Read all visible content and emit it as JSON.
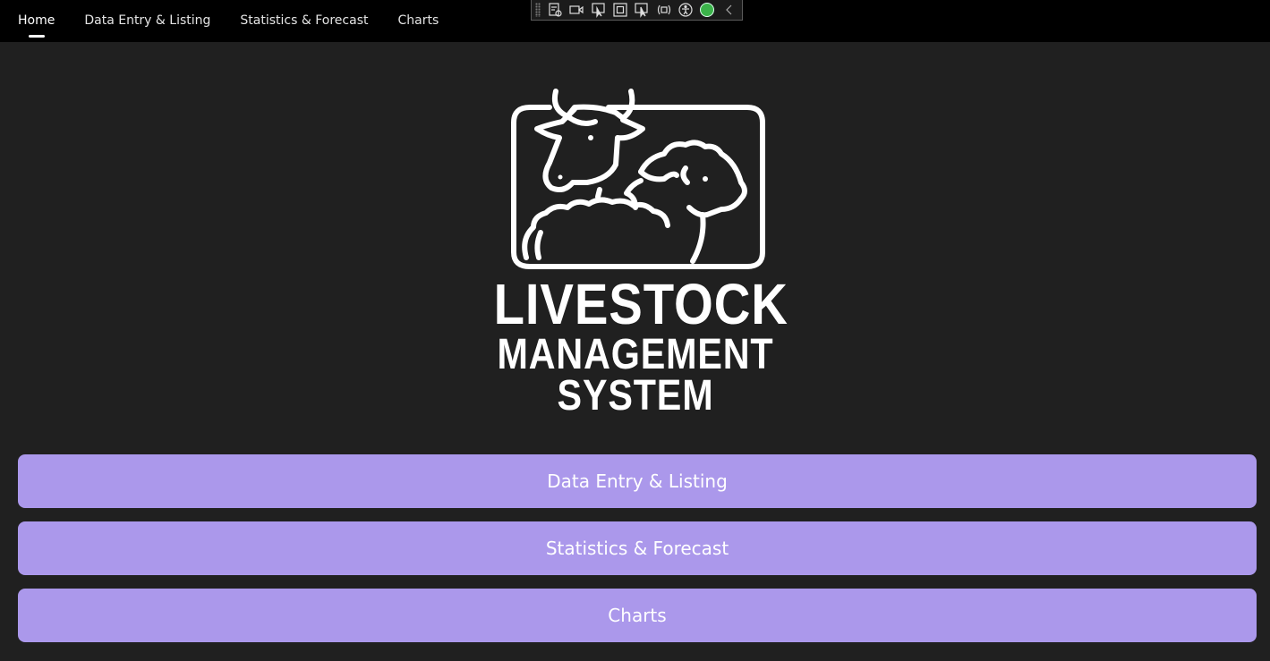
{
  "nav": {
    "tabs": [
      {
        "label": "Home",
        "active": true
      },
      {
        "label": "Data Entry & Listing",
        "active": false
      },
      {
        "label": "Statistics & Forecast",
        "active": false
      },
      {
        "label": "Charts",
        "active": false
      }
    ]
  },
  "logo": {
    "line1": "LIVESTOCK",
    "line2": "MANAGEMENT",
    "line3": "SYSTEM"
  },
  "buttons": {
    "data_entry": "Data Entry & Listing",
    "statistics": "Statistics & Forecast",
    "charts": "Charts"
  },
  "colors": {
    "background": "#202020",
    "topbar": "#000000",
    "button": "#ab98eb",
    "text": "#ffffff"
  },
  "debug_toolbar": {
    "icons": [
      "live-visual-tree-icon",
      "record-icon",
      "select-element-icon",
      "display-layout-adorners-icon",
      "track-focus-icon",
      "binding-failures-icon",
      "accessibility-icon",
      "hot-reload-status-icon",
      "collapse-toolbar-icon"
    ]
  }
}
